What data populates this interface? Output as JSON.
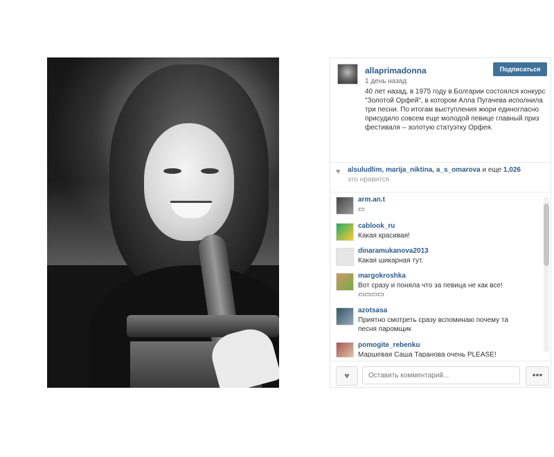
{
  "post": {
    "username": "allaprimadonna",
    "follow_label": "Подписаться",
    "time": "1 день назад",
    "caption": "40 лет назад, в 1975 году в Болгарии состоялся конкурс \"Золотой Орфей\", в котором Алла Пугачева исполнила три песни. По итогам выступления жюри единогласно присудило совсем еще молодой певице главный приз фестиваля – золотую статуэтку Орфея."
  },
  "likes": {
    "users": "alsuludlim, marija_niktina, a_s_omarova",
    "more_prefix": "и еще",
    "count": "1,026",
    "suffix": "это нравится"
  },
  "comments": [
    {
      "name": "arm.an.t",
      "text": "▭"
    },
    {
      "name": "cablook_ru",
      "text": "Какая красивая!"
    },
    {
      "name": "dinaramukanova2013",
      "text": "Какая шикарная тут."
    },
    {
      "name": "margokroshka",
      "text": "Вот сразу и поняла что за певица не как все!▭▭▭▭"
    },
    {
      "name": "azotsasa",
      "text": "Приятно смотреть сразу вспоминаю почему та песня паромщик"
    },
    {
      "name": "pomogite_rebenku",
      "text": "Маршевая Саша Таранова очень PLEASE!"
    }
  ],
  "footer": {
    "comment_placeholder": "Оставить комментарий...",
    "more_label": "•••"
  },
  "colors": {
    "link": "#2b5a8a",
    "follow_bg": "#3f729b"
  },
  "icons": {
    "like": "heart-icon",
    "more": "ellipsis-icon"
  }
}
